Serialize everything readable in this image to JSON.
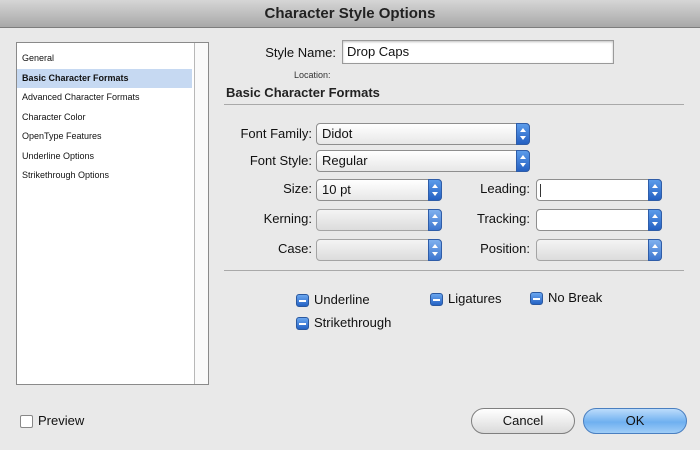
{
  "window": {
    "title": "Character Style Options"
  },
  "sidebar": {
    "items": [
      {
        "label": "General"
      },
      {
        "label": "Basic Character Formats"
      },
      {
        "label": "Advanced Character Formats"
      },
      {
        "label": "Character Color"
      },
      {
        "label": "OpenType Features"
      },
      {
        "label": "Underline Options"
      },
      {
        "label": "Strikethrough Options"
      }
    ],
    "selected": "Basic Character Formats"
  },
  "style_name": {
    "label": "Style Name:",
    "value": "Drop Caps"
  },
  "location": {
    "label": "Location:"
  },
  "section": {
    "title": "Basic Character Formats"
  },
  "fields": {
    "font_family": {
      "label": "Font Family:",
      "value": "Didot"
    },
    "font_style": {
      "label": "Font Style:",
      "value": "Regular"
    },
    "size": {
      "label": "Size:",
      "value": "10 pt"
    },
    "leading": {
      "label": "Leading:",
      "value": ""
    },
    "kerning": {
      "label": "Kerning:",
      "value": ""
    },
    "tracking": {
      "label": "Tracking:",
      "value": ""
    },
    "case": {
      "label": "Case:",
      "value": ""
    },
    "position": {
      "label": "Position:",
      "value": ""
    }
  },
  "checkboxes": {
    "underline": {
      "label": "Underline",
      "state": "mixed"
    },
    "ligatures": {
      "label": "Ligatures",
      "state": "mixed"
    },
    "no_break": {
      "label": "No Break",
      "state": "mixed"
    },
    "strikethrough": {
      "label": "Strikethrough",
      "state": "mixed"
    }
  },
  "footer": {
    "preview_label": "Preview",
    "preview_checked": false,
    "cancel_label": "Cancel",
    "ok_label": "OK"
  },
  "colors": {
    "accent": "#2f6fd0",
    "selection": "#c6d9f2",
    "default_button": "#6fb0f0"
  }
}
